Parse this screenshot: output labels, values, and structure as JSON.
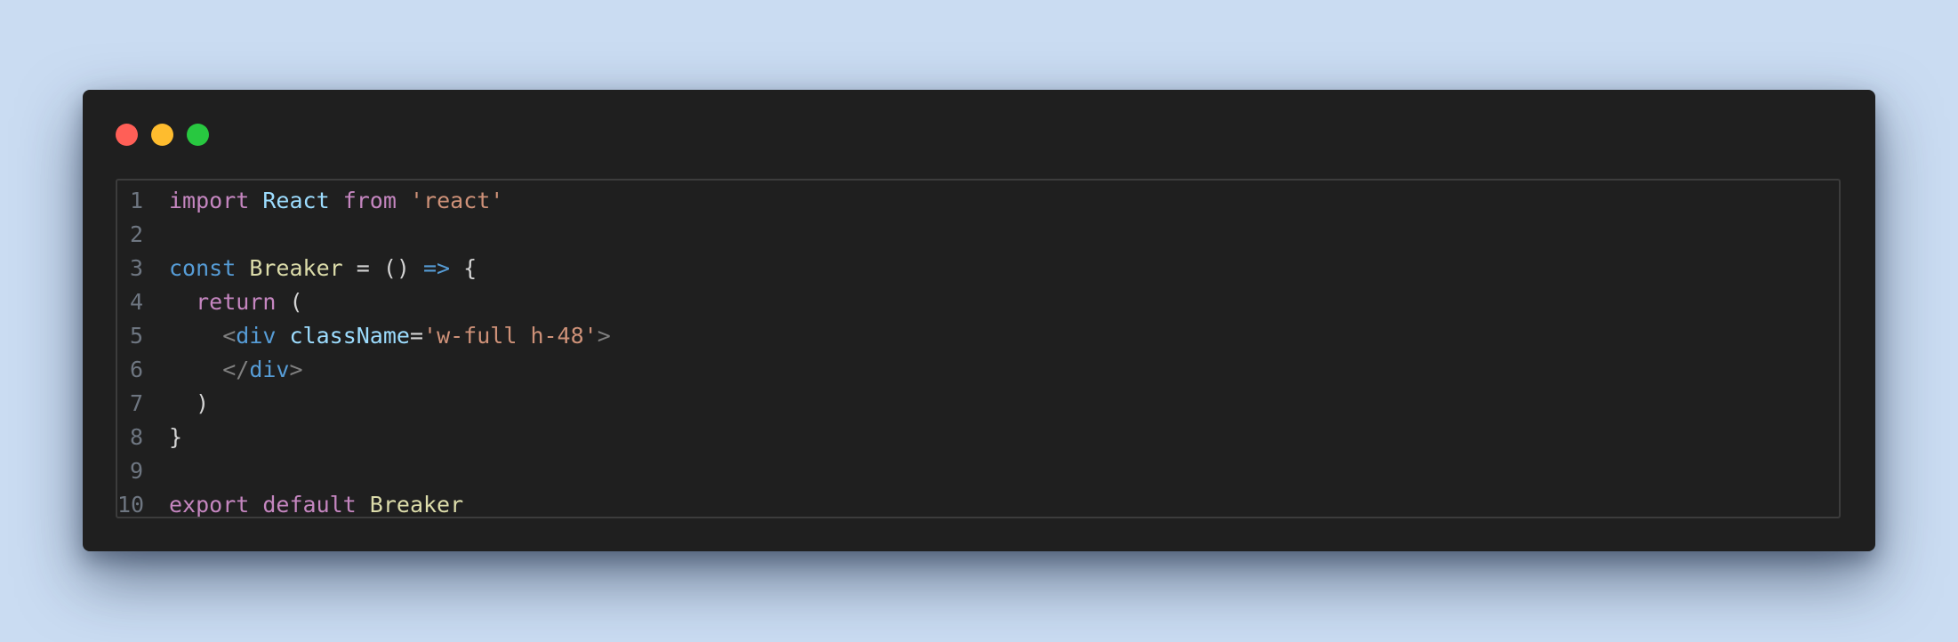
{
  "colors": {
    "background": "#cadcf2",
    "window": "#1f1f1f",
    "close": "#ff5f57",
    "minimize": "#febc2e",
    "maximize": "#28c840",
    "keyword_import": "#c586c0",
    "keyword_decl": "#569cd6",
    "identifier": "#9cdcfe",
    "function": "#dcdcaa",
    "string": "#ce9178"
  },
  "editor": {
    "lines": [
      {
        "num": "1",
        "tokens": [
          {
            "t": "import",
            "c": "kw"
          },
          {
            "t": " ",
            "c": "punc"
          },
          {
            "t": "React",
            "c": "id"
          },
          {
            "t": " ",
            "c": "punc"
          },
          {
            "t": "from",
            "c": "kw"
          },
          {
            "t": " ",
            "c": "punc"
          },
          {
            "t": "'react'",
            "c": "str"
          }
        ]
      },
      {
        "num": "2",
        "tokens": []
      },
      {
        "num": "3",
        "tokens": [
          {
            "t": "const",
            "c": "kw2"
          },
          {
            "t": " ",
            "c": "punc"
          },
          {
            "t": "Breaker",
            "c": "fn"
          },
          {
            "t": " = () ",
            "c": "punc"
          },
          {
            "t": "=>",
            "c": "kw2"
          },
          {
            "t": " {",
            "c": "punc"
          }
        ]
      },
      {
        "num": "4",
        "tokens": [
          {
            "t": "  ",
            "c": "punc"
          },
          {
            "t": "return",
            "c": "kw"
          },
          {
            "t": " (",
            "c": "punc"
          }
        ]
      },
      {
        "num": "5",
        "tokens": [
          {
            "t": "    ",
            "c": "punc"
          },
          {
            "t": "<",
            "c": "tagp"
          },
          {
            "t": "div",
            "c": "tag"
          },
          {
            "t": " ",
            "c": "punc"
          },
          {
            "t": "className",
            "c": "attr"
          },
          {
            "t": "=",
            "c": "punc"
          },
          {
            "t": "'w-full h-48'",
            "c": "str"
          },
          {
            "t": ">",
            "c": "tagp"
          }
        ]
      },
      {
        "num": "6",
        "tokens": [
          {
            "t": "    ",
            "c": "punc"
          },
          {
            "t": "</",
            "c": "tagp"
          },
          {
            "t": "div",
            "c": "tag"
          },
          {
            "t": ">",
            "c": "tagp"
          }
        ]
      },
      {
        "num": "7",
        "tokens": [
          {
            "t": "  )",
            "c": "punc"
          }
        ]
      },
      {
        "num": "8",
        "tokens": [
          {
            "t": "}",
            "c": "punc"
          }
        ]
      },
      {
        "num": "9",
        "tokens": []
      },
      {
        "num": "10",
        "tokens": [
          {
            "t": "export",
            "c": "kw"
          },
          {
            "t": " ",
            "c": "punc"
          },
          {
            "t": "default",
            "c": "kw"
          },
          {
            "t": " ",
            "c": "punc"
          },
          {
            "t": "Breaker",
            "c": "fn"
          }
        ]
      }
    ]
  }
}
